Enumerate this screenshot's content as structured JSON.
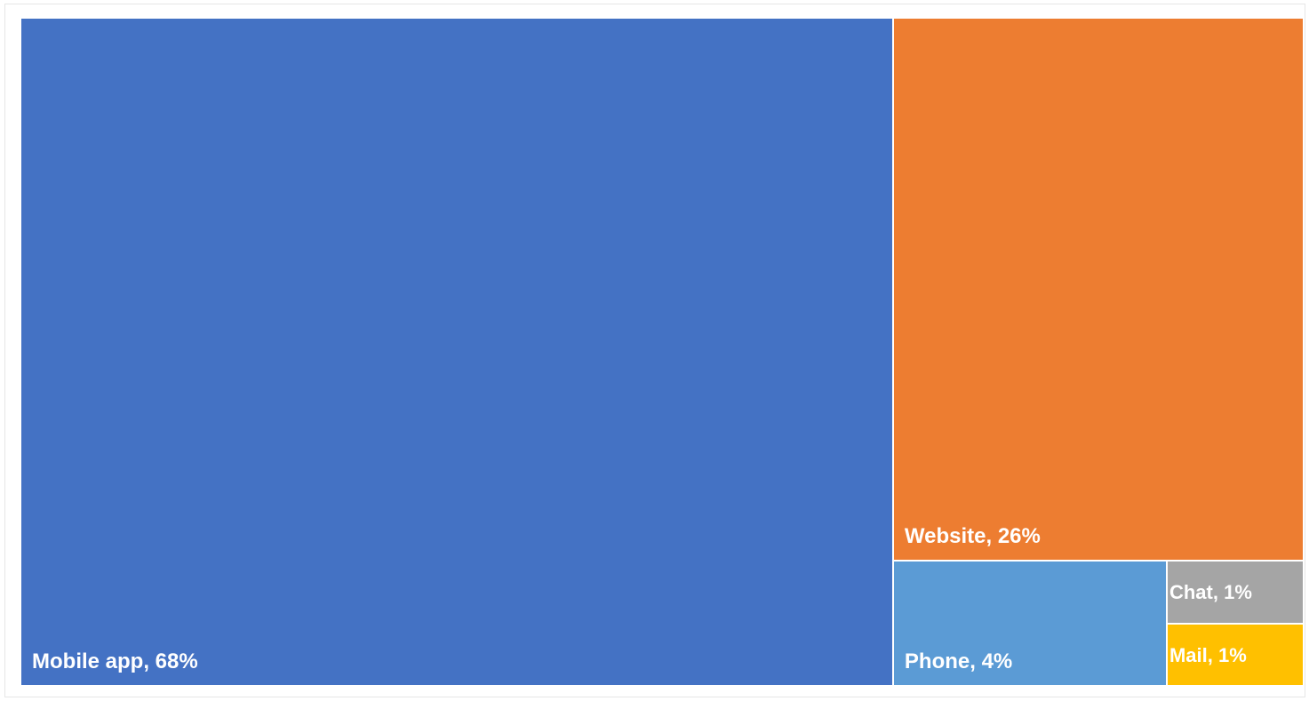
{
  "chart_data": {
    "type": "treemap",
    "title": "",
    "items": [
      {
        "label": "Mobile app, 68%",
        "name": "Mobile app",
        "value": 68,
        "color": "#4472C4"
      },
      {
        "label": "Website, 26%",
        "name": "Website",
        "value": 26,
        "color": "#ED7D31"
      },
      {
        "label": "Phone, 4%",
        "name": "Phone",
        "value": 4,
        "color": "#5B9BD5"
      },
      {
        "label": "Chat, 1%",
        "name": "Chat",
        "value": 1,
        "color": "#A5A5A5"
      },
      {
        "label": "Mail, 1%",
        "name": "Mail",
        "value": 1,
        "color": "#FFC000"
      }
    ]
  }
}
